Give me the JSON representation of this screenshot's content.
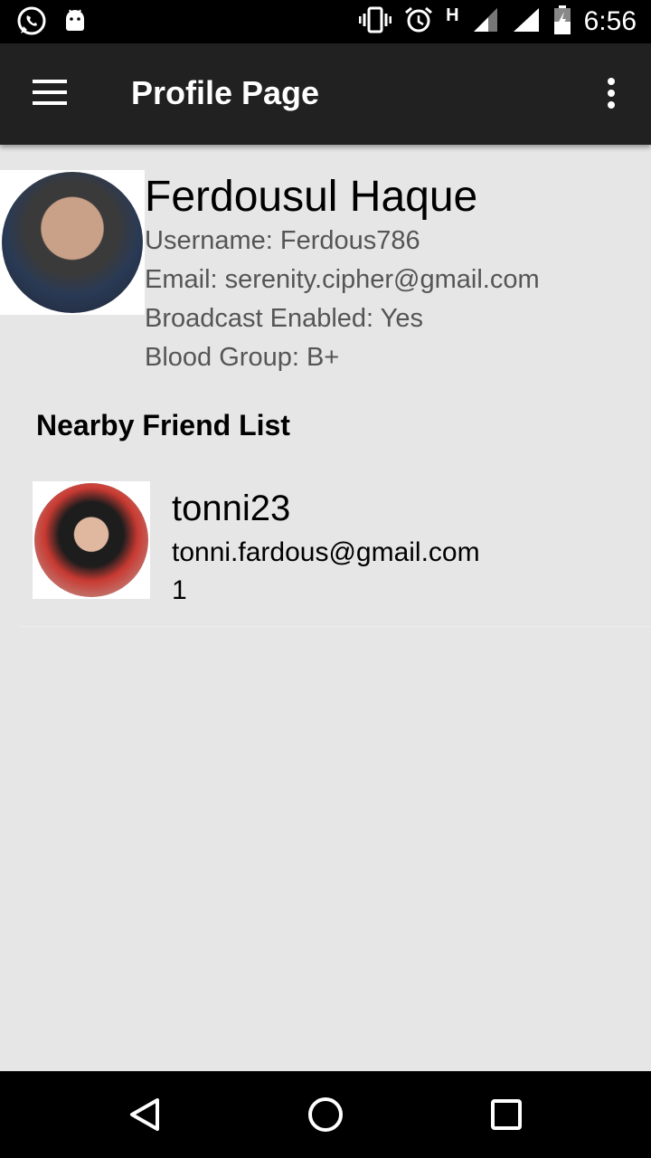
{
  "status_bar": {
    "time": "6:56",
    "network": "H",
    "icons": [
      "whatsapp-icon",
      "android-icon",
      "vibrate-icon",
      "alarm-icon",
      "signal-icon",
      "wifi-icon",
      "battery-icon"
    ]
  },
  "toolbar": {
    "title": "Profile Page"
  },
  "profile": {
    "name": "Ferdousul Haque",
    "username": "Username: Ferdous786",
    "email": "Email: serenity.cipher@gmail.com",
    "broadcast": "Broadcast Enabled: Yes",
    "blood_group": "Blood Group: B+"
  },
  "friends_section": {
    "title": "Nearby Friend List",
    "items": [
      {
        "name": "tonni23",
        "email": "tonni.fardous@gmail.com",
        "value": "1"
      }
    ]
  },
  "colors": {
    "toolbar": "#212121",
    "background": "#e6e6e6",
    "status_bar": "#000000"
  }
}
